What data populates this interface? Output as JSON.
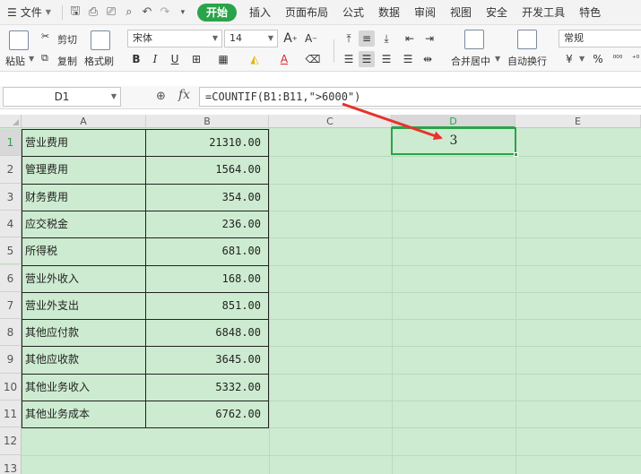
{
  "menu": {
    "file": "文件",
    "tabs": [
      "开始",
      "插入",
      "页面布局",
      "公式",
      "数据",
      "审阅",
      "视图",
      "安全",
      "开发工具",
      "特色"
    ]
  },
  "ribbon": {
    "paste": "粘贴",
    "cut": "剪切",
    "copy": "复制",
    "format_painter": "格式刷",
    "font_name": "宋体",
    "font_size": "14",
    "merge_center": "合并居中",
    "wrap_text": "自动换行",
    "number_format": "常规",
    "percent": "%"
  },
  "formula_bar": {
    "name_box": "D1",
    "fx": "fx",
    "formula": "=COUNTIF(B1:B11,\">6000\")"
  },
  "sheet": {
    "columns": [
      "A",
      "B",
      "C",
      "D",
      "E"
    ],
    "active_column": "D",
    "rows": [
      {
        "num": "1",
        "a": "营业费用",
        "b": "21310.00"
      },
      {
        "num": "2",
        "a": "管理费用",
        "b": "1564.00"
      },
      {
        "num": "3",
        "a": "财务费用",
        "b": "354.00"
      },
      {
        "num": "4",
        "a": "应交税金",
        "b": "236.00"
      },
      {
        "num": "5",
        "a": "所得税",
        "b": "681.00"
      },
      {
        "num": "6",
        "a": "营业外收入",
        "b": "168.00"
      },
      {
        "num": "7",
        "a": "营业外支出",
        "b": "851.00"
      },
      {
        "num": "8",
        "a": "其他应付款",
        "b": "6848.00"
      },
      {
        "num": "9",
        "a": "其他应收款",
        "b": "3645.00"
      },
      {
        "num": "10",
        "a": "其他业务收入",
        "b": "5332.00"
      },
      {
        "num": "11",
        "a": "其他业务成本",
        "b": "6762.00"
      },
      {
        "num": "12",
        "a": "",
        "b": ""
      },
      {
        "num": "13",
        "a": "",
        "b": ""
      }
    ],
    "d1_value": "3"
  },
  "colors": {
    "accent": "#2aa34a",
    "sheet_bg": "#cdebd0",
    "arrow": "#e8322a"
  }
}
